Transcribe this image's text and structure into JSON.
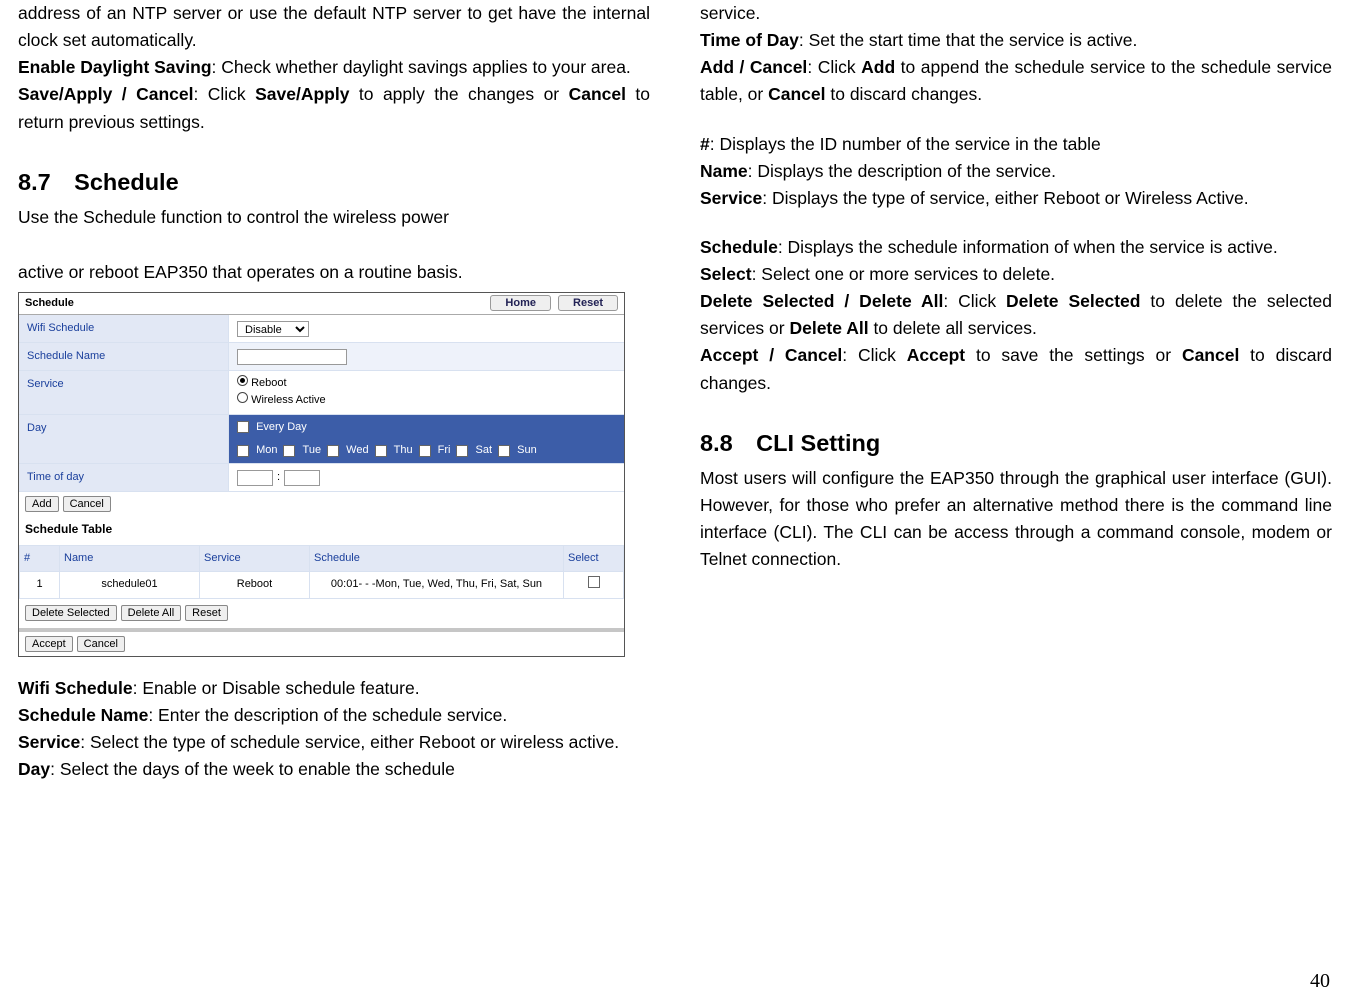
{
  "left": {
    "p1a": "address of an NTP server or use the default NTP server to get have the internal clock set automatically.",
    "eds_b": "Enable Daylight Saving",
    "eds_t": ": Check whether daylight savings applies to your area.",
    "sac_b": "Save/Apply / Cancel",
    "sac_t1": ": Click ",
    "sac_b2": "Save/Apply",
    "sac_t2": " to apply the changes or ",
    "sac_b3": "Cancel",
    "sac_t3": " to return previous settings.",
    "h2": "8.7 Schedule",
    "h2_sub": "Use the Schedule function to control the wireless power",
    "spacer": "",
    "p2": "active or reboot EAP350 that operates on a routine basis.",
    "ss": {
      "title": "Schedule",
      "home": "Home",
      "reset": "Reset",
      "rows": {
        "wifi_lab": "Wifi Schedule",
        "wifi_val": "Disable",
        "name_lab": "Schedule Name",
        "svc_lab": "Service",
        "svc_o1": "Reboot",
        "svc_o2": "Wireless Active",
        "day_lab": "Day",
        "day_all": "Every Day",
        "days": [
          "Mon",
          "Tue",
          "Wed",
          "Thu",
          "Fri",
          "Sat",
          "Sun"
        ],
        "tod_lab": "Time of day"
      },
      "add": "Add",
      "cancel": "Cancel",
      "tbl_title": "Schedule Table",
      "th": [
        "#",
        "Name",
        "Service",
        "Schedule",
        "Select"
      ],
      "row": {
        "n": "1",
        "name": "schedule01",
        "svc": "Reboot",
        "sched": "00:01- - -Mon, Tue, Wed, Thu, Fri, Sat, Sun"
      },
      "ds": "Delete Selected",
      "da": "Delete All",
      "rst": "Reset",
      "accept": "Accept",
      "cancel2": "Cancel"
    },
    "wifi_b": "Wifi Schedule",
    "wifi_t": ": Enable or Disable schedule feature.",
    "sname_b": "Schedule Name",
    "sname_t": ": Enter the description of the schedule service.",
    "svc_b": "Service",
    "svc_t": ": Select the type of schedule service, either Reboot or wireless active.",
    "day_b": "Day",
    "day_t": ": Select the days of the week to enable the schedule"
  },
  "right": {
    "p1": "service.",
    "tod_b": "Time of Day",
    "tod_t": ": Set the start time that the service is active.",
    "ac_b": "Add / Cancel",
    "ac_t1": ": Click ",
    "ac_b2": "Add",
    "ac_t2": " to append the schedule service to the schedule service table, or ",
    "ac_b3": "Cancel",
    "ac_t3": " to discard changes.",
    "hash_b": "#",
    "hash_t": ": Displays the ID number of the service in the table",
    "name_b": "Name",
    "name_t": ": Displays the description of the service.",
    "svc_b": "Service",
    "svc_t": ": Displays the type of service, either Reboot or Wireless Active.",
    "sch_b": "Schedule",
    "sch_t": ": Displays the schedule information of when the service is active.",
    "sel_b": "Select",
    "sel_t": ": Select one or more services to delete.",
    "dd_b": "Delete Selected / Delete All",
    "dd_t1": ": Click ",
    "dd_b2": "Delete Selected",
    "dd_t2": " to delete the selected services or ",
    "dd_b3": "Delete All",
    "dd_t3": " to delete all services.",
    "acc_b": "Accept / Cancel",
    "acc_t1": ": Click ",
    "acc_b2": "Accept",
    "acc_t2": " to save the settings or ",
    "acc_b3": "Cancel",
    "acc_t3": " to discard changes.",
    "h2": "8.8 CLI Setting",
    "p_cli": "Most users will configure the EAP350 through the graphical user interface (GUI). However, for those who prefer an alternative method there is the command line interface (CLI). The CLI can be access through a command console, modem or Telnet connection."
  },
  "pageNum": "40"
}
